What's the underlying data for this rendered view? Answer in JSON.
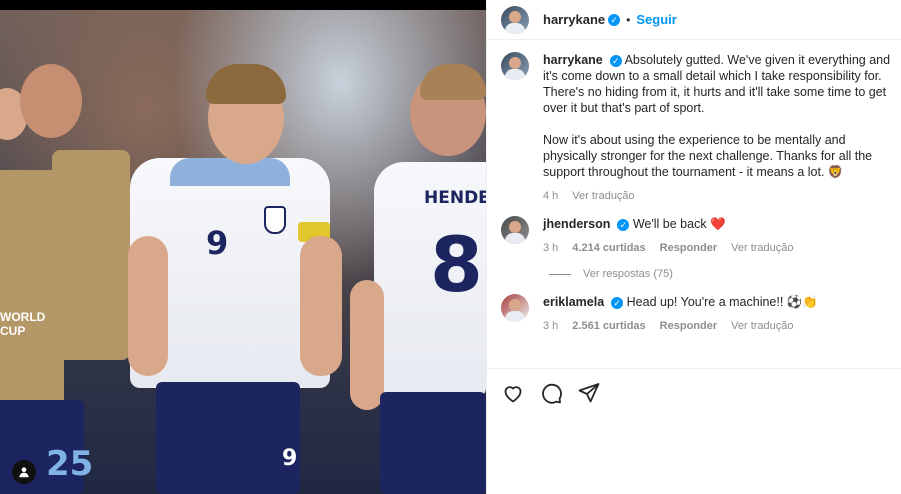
{
  "post": {
    "author": "harrykane",
    "dot": "•",
    "follow_label": "Seguir"
  },
  "caption": {
    "username": "harrykane",
    "text_p1": "Absolutely gutted. We've given it everything and it's come down to a small detail which I take responsibility for. There's no hiding from it, it hurts and it'll take some time to get over it but that's part of sport.",
    "text_p2": "Now it's about using the experience to be mentally and physically stronger for the next challenge. Thanks for all the support throughout the tournament - it means a lot. 🦁",
    "time": "4 h",
    "translate": "Ver tradução"
  },
  "comments": [
    {
      "username": "jhenderson",
      "text": "We'll be back ❤️",
      "time": "3 h",
      "likes": "4.214 curtidas",
      "reply": "Responder",
      "translate": "Ver tradução",
      "view_replies": "Ver respostas (75)"
    },
    {
      "username": "eriklamela",
      "text": "Head up! You're a machine!! ⚽👏",
      "time": "3 h",
      "likes": "2.561 curtidas",
      "reply": "Responder",
      "translate": "Ver tradução"
    }
  ],
  "photo": {
    "jersey_numbers": [
      "9",
      "8",
      "25"
    ],
    "back_name": "HENDERS",
    "banner": "WORLD CUP"
  },
  "icons": [
    "heart-icon",
    "comment-icon",
    "share-icon",
    "verified-icon",
    "user-icon"
  ],
  "colors": {
    "accent": "#0095f6",
    "meta_gray": "#8e8e8e",
    "heart_red": "#ed4956"
  }
}
